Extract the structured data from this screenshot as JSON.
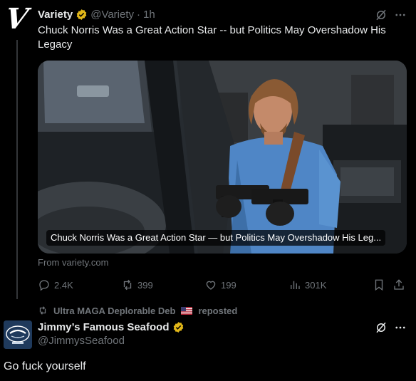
{
  "tweet": {
    "avatar_letter": "V",
    "author_name": "Variety",
    "author_handle": "@Variety",
    "separator": "·",
    "time": "1h",
    "text": "Chuck Norris Was a Great Action Star -- but Politics May Overshadow His Legacy",
    "card": {
      "caption": "Chuck Norris Was a Great Action Star — but Politics May Overshadow His Leg...",
      "source": "From variety.com"
    },
    "actions": {
      "replies": "2.4K",
      "reposts": "399",
      "likes": "199",
      "views": "301K"
    }
  },
  "repost": {
    "reposted_by": "Ultra MAGA Deplorable Deb",
    "label": "reposted"
  },
  "reply": {
    "author_name": "Jimmy’s Famous Seafood",
    "author_handle": "@JimmysSeafood",
    "avatar_text": "Jimmy's Famous Seafood",
    "text": "Go fuck yourself"
  },
  "icons": {
    "verified": "verified-badge-icon",
    "grok": "grok-icon",
    "more": "more-icon",
    "reply": "reply-icon",
    "repost": "repost-icon",
    "like": "like-icon",
    "views": "views-icon",
    "bookmark": "bookmark-icon",
    "share": "share-icon",
    "flag": "us-flag-icon"
  },
  "colors": {
    "background": "#000000",
    "text": "#e7e9ea",
    "muted": "#71767b",
    "verified_gold": "#e2b719"
  }
}
